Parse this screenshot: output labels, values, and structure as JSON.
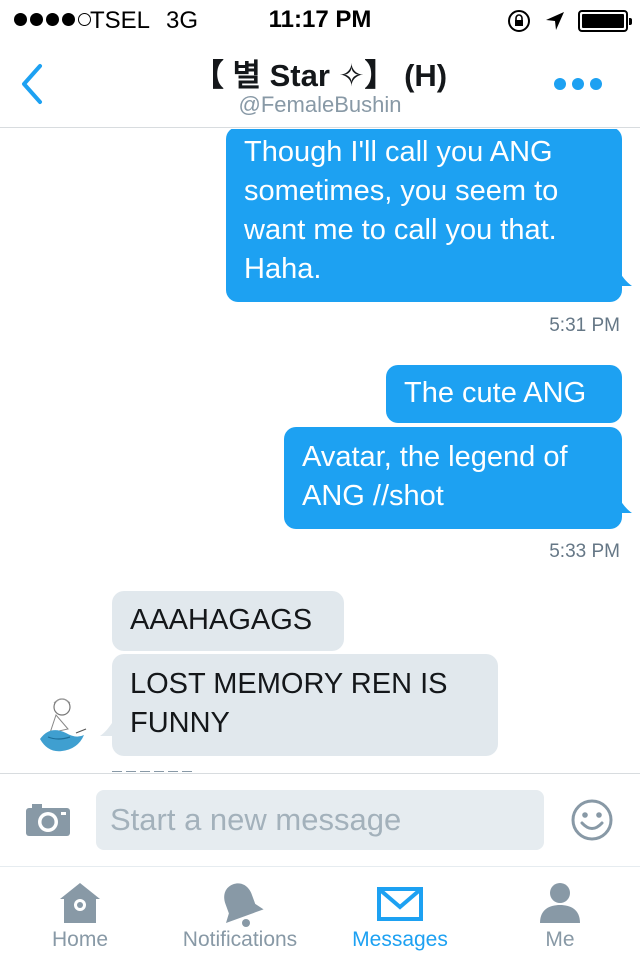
{
  "status_bar": {
    "carrier": "TSEL",
    "network": "3G",
    "time": "11:17 PM"
  },
  "header": {
    "title": "【 별 Star ✧】 (H)",
    "handle": "@FemaleBushin"
  },
  "messages": [
    {
      "direction": "outgoing",
      "text": "Though I'll call you ANG sometimes, you seem to want me to call you that. Haha."
    },
    {
      "type": "timestamp",
      "text": "5:31 PM"
    },
    {
      "direction": "outgoing",
      "text": "The cute ANG"
    },
    {
      "direction": "outgoing",
      "text": "Avatar, the legend of ANG //shot"
    },
    {
      "type": "timestamp",
      "text": "5:33 PM"
    },
    {
      "direction": "incoming",
      "text": "AAAHAGAGS"
    },
    {
      "direction": "incoming",
      "text": "LOST MEMORY REN IS FUNNY"
    }
  ],
  "composer": {
    "placeholder": "Start a new message"
  },
  "tabs": [
    {
      "label": "Home",
      "icon": "home-icon",
      "active": false
    },
    {
      "label": "Notifications",
      "icon": "bell-icon",
      "active": false
    },
    {
      "label": "Messages",
      "icon": "envelope-icon",
      "active": true
    },
    {
      "label": "Me",
      "icon": "person-icon",
      "active": false
    }
  ],
  "colors": {
    "accent": "#1da1f2",
    "incoming_bubble": "#e1e8ed",
    "muted_text": "#8899a6"
  }
}
